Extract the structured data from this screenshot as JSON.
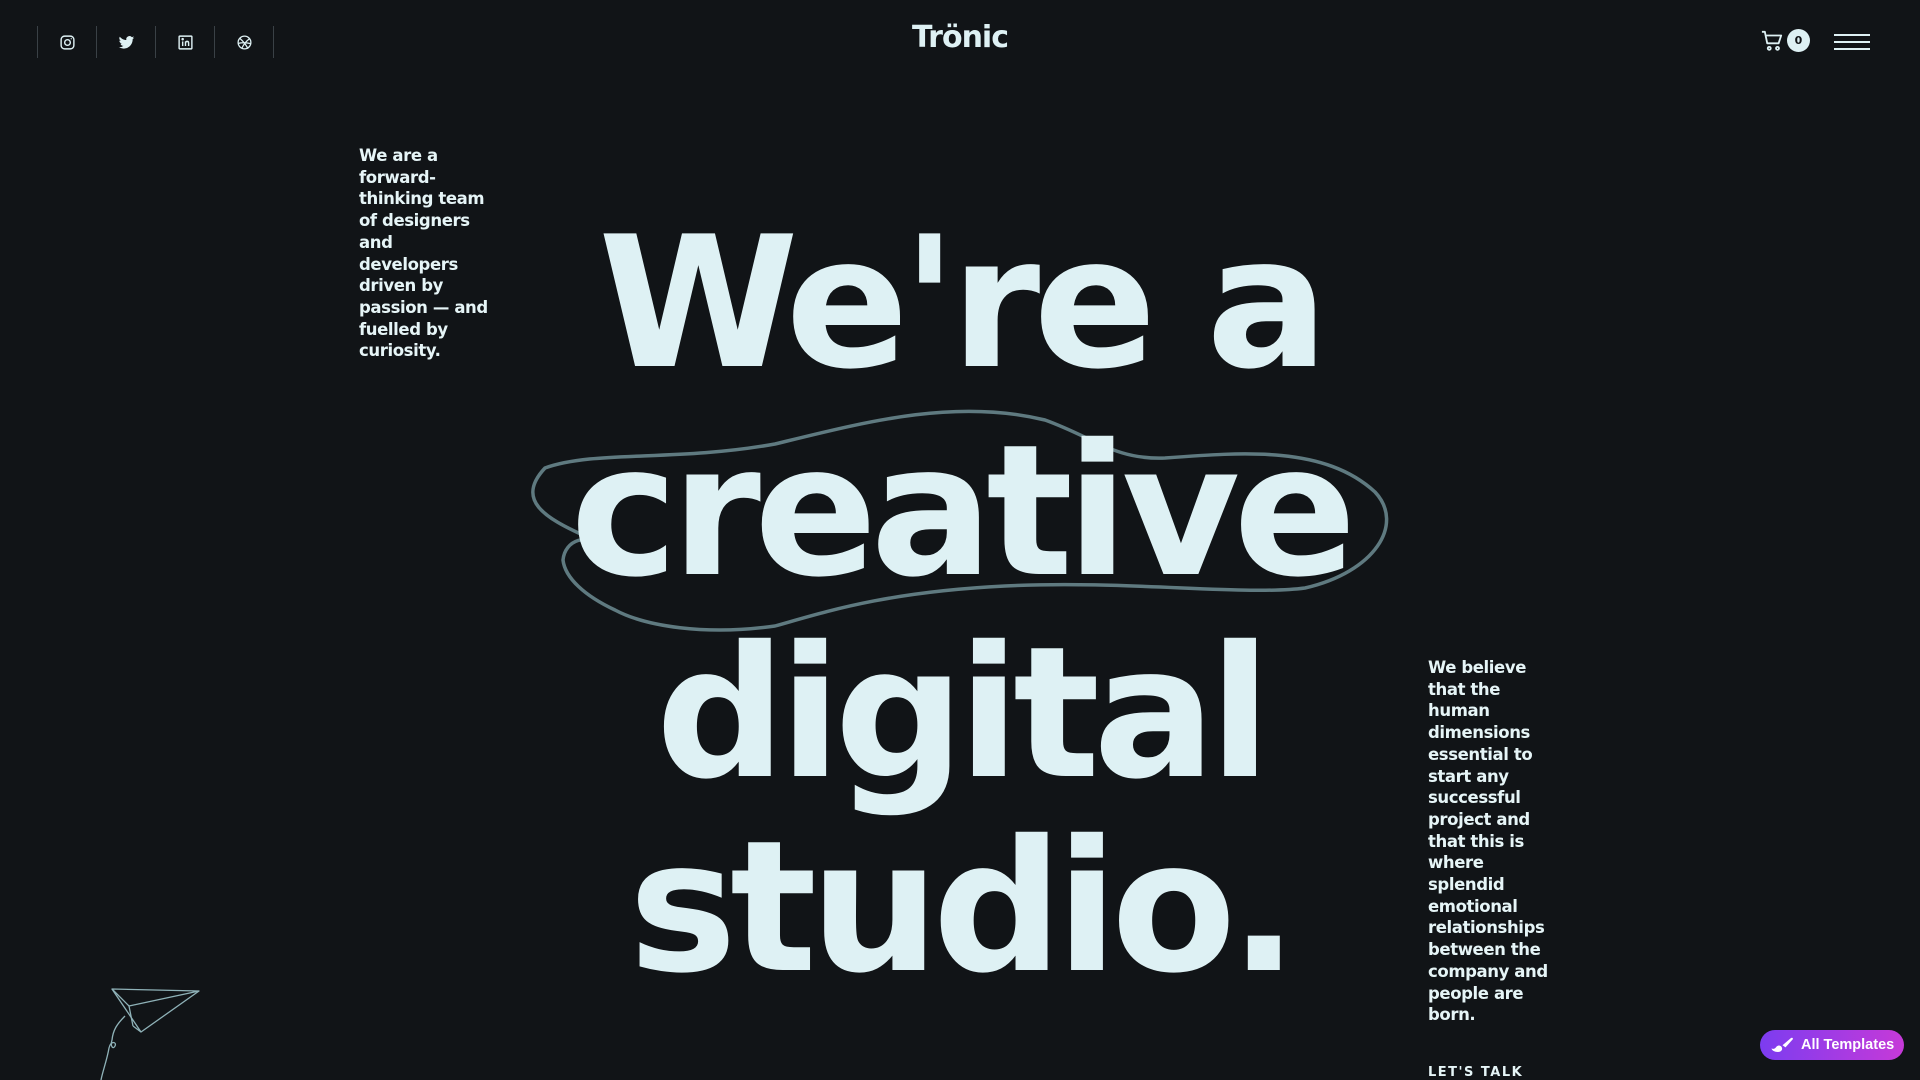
{
  "header": {
    "logo": "Trönic",
    "social": [
      {
        "name": "instagram-icon"
      },
      {
        "name": "twitter-icon"
      },
      {
        "name": "linkedin-icon"
      },
      {
        "name": "dribbble-icon"
      }
    ],
    "cart": {
      "icon": "cart-icon",
      "count": "0"
    },
    "menu_icon": "hamburger-menu-icon"
  },
  "intro": {
    "text": "We are a forward-thinking team of designers and developers driven by passion — and fuelled by curiosity."
  },
  "hero": {
    "lines": [
      "We're a",
      "creative",
      "digital",
      "studio."
    ]
  },
  "belief": {
    "text": "We believe that the human dimensions essential to start any successful project and that this is where splendid emotional relationships between the company and people are born.",
    "cta": "LET'S TALK"
  },
  "badge": {
    "label": "All Templates"
  },
  "colors": {
    "background": "#111417",
    "text": "#def1f4",
    "scribble": "#5f7a80",
    "badge_start": "#7c3cf0",
    "badge_end": "#c63ad8"
  }
}
